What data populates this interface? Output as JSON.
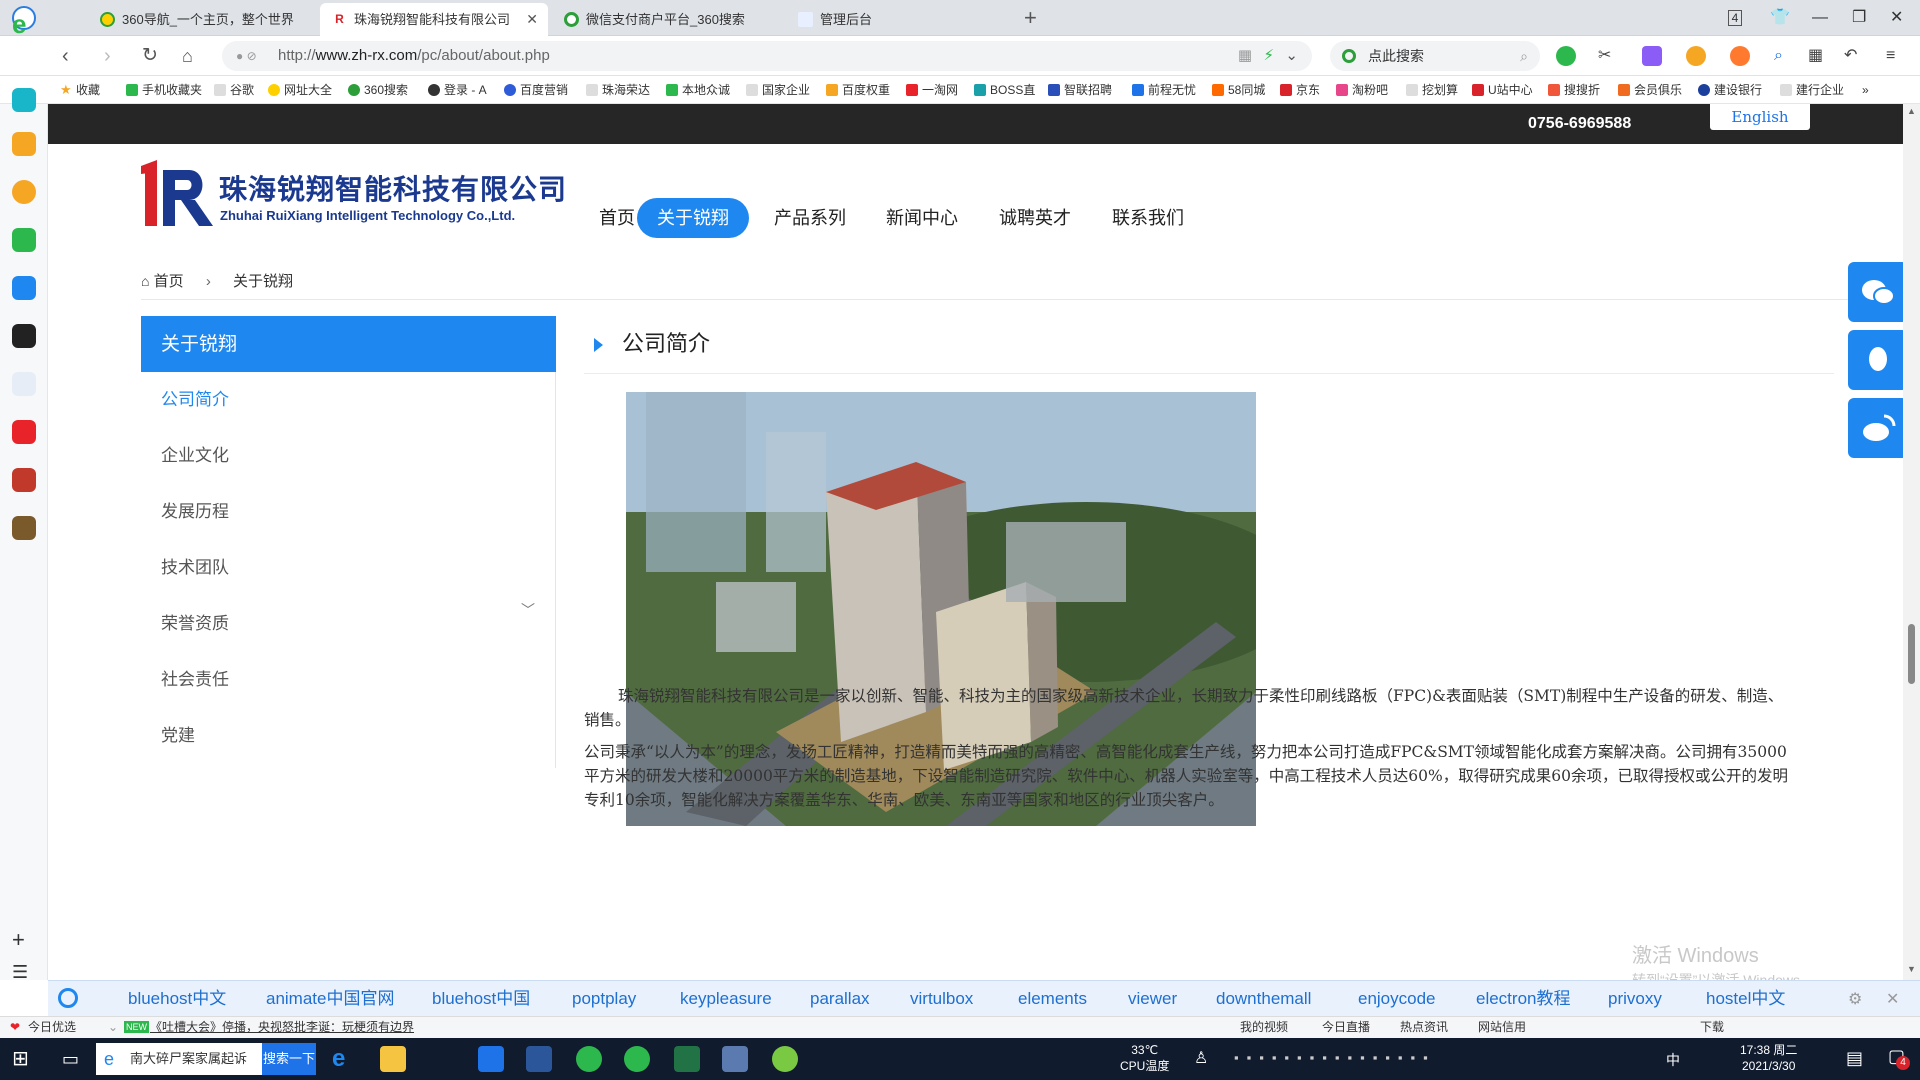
{
  "browser": {
    "tabs": [
      {
        "title": "360导航_一个主页，整个世界",
        "active": false
      },
      {
        "title": "珠海锐翔智能科技有限公司",
        "active": true
      },
      {
        "title": "微信支付商户平台_360搜索",
        "active": false
      },
      {
        "title": "管理后台",
        "active": false
      }
    ],
    "tab_count": "4",
    "url_prefix": "http://",
    "url_domain": "www.zh-rx.com",
    "url_path": "/pc/about/about.php",
    "search_placeholder": "点此搜索",
    "bookmarks": [
      "收藏",
      "手机收藏夹",
      "谷歌",
      "网址大全",
      "360搜索",
      "登录 - A",
      "百度营销",
      "珠海荣达",
      "本地众诚",
      "国家企业",
      "百度权重",
      "一淘网",
      "BOSS直",
      "智联招聘",
      "前程无忧",
      "58同城",
      "京东",
      "淘粉吧",
      "挖划算",
      "U站中心",
      "搜搜折",
      "会员俱乐",
      "建设银行",
      "建行企业"
    ]
  },
  "site": {
    "phone": "0756-6969588",
    "english_label": "English",
    "logo_cn": "珠海锐翔智能科技有限公司",
    "logo_en": "Zhuhai RuiXiang Intelligent Technology Co.,Ltd.",
    "nav": [
      "首页",
      "关于锐翔",
      "产品系列",
      "新闻中心",
      "诚聘英才",
      "联系我们"
    ],
    "nav_active": 1,
    "breadcrumb": {
      "home": "首页",
      "sep": "›",
      "current": "关于锐翔"
    },
    "sidebar": {
      "header": "关于锐翔",
      "items": [
        "公司简介",
        "企业文化",
        "发展历程",
        "技术团队",
        "荣誉资质",
        "社会责任",
        "党建"
      ]
    },
    "content": {
      "title": "公司简介",
      "paragraph1": "珠海锐翔智能科技有限公司是一家以创新、智能、科技为主的国家级高新技术企业，长期致力于柔性印刷线路板（FPC)&表面贴装（SMT)制程中生产设备的研发、制造、销售。",
      "paragraph2": "公司秉承“以人为本”的理念，发扬工匠精神，打造精而美特而强的高精密、高智能化成套生产线，努力把本公司打造成FPC&SMT领域智能化成套方案解决商。公司拥有35000平方米的研发大楼和20000平方米的制造基地，下设智能制造研究院、软件中心、机器人实验室等，中高工程技术人员达60%，取得研究成果60余项，已取得授权或公开的发明专利10余项，智能化解决方案覆盖华东、华南、欧美、东南亚等国家和地区的行业顶尖客户。"
    }
  },
  "linkbar": [
    "bluehost中文",
    "animate中国官网",
    "bluehost中国",
    "poptplay",
    "keypleasure",
    "parallax",
    "virtulbox",
    "elements",
    "viewer",
    "downthemall",
    "enjoycode",
    "electron教程",
    "privoxy",
    "hostel中文"
  ],
  "statusbar": {
    "left1": "今日优选",
    "news": "《吐槽大会》停播，央视怒批李诞：玩梗须有边界",
    "right": [
      "我的视频",
      "今日直播",
      "热点资讯",
      "网站信用",
      "下载"
    ]
  },
  "watermark": {
    "line1": "激活 Windows",
    "line2": "转到“设置”以激活 Windows。"
  },
  "taskbar": {
    "app_label": "南大碎尸案家属起诉",
    "search_button": "搜索一下",
    "temp": "33℃",
    "temp_label": "CPU温度",
    "time": "17:38 周二",
    "date": "2021/3/30",
    "ime": "中",
    "notif_count": "4"
  },
  "colors": {
    "accent": "#1e88f0",
    "topstrip": "#262626",
    "logo": "#1b3a8f"
  }
}
